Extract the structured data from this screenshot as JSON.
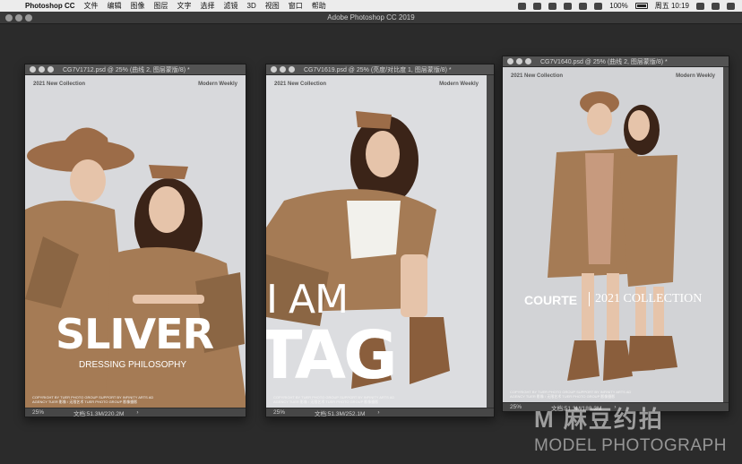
{
  "menubar": {
    "app_name": "Photoshop CC",
    "items": [
      "文件",
      "编辑",
      "图像",
      "图层",
      "文字",
      "选择",
      "滤镜",
      "3D",
      "视图",
      "窗口",
      "帮助"
    ],
    "battery": "100%",
    "clock": "周五 10:19"
  },
  "app_title": "Adobe Photoshop CC 2019",
  "documents": [
    {
      "title": "CG7V1712.psd @ 25% (曲线 2, 图层蒙版/8) *",
      "zoom": "25%",
      "doc_info": "文档:51.3M/220.2M",
      "poster": {
        "top_left": "2021 New Collection",
        "top_right": "Modern Weekly",
        "headline": "SLIVER",
        "subhead": "DRESSING PHILOSOPHY",
        "copyright": "COPYRIGHT BY TUER PHOTO GROUP SUPPORT BY INFINITY ARTS AD AGENCY TUER 影像 / 无限艺术 TUER PHOTO GROUP 影像摄影"
      }
    },
    {
      "title": "CG7V1619.psd @ 25% (亮度/对比度 1, 图层蒙版/8) *",
      "zoom": "25%",
      "doc_info": "文档:51.3M/252.1M",
      "poster": {
        "top_left": "2021 New Collection",
        "top_right": "Modern Weekly",
        "headline_1": "I AM",
        "headline_2": "TAG",
        "copyright": "COPYRIGHT BY TUER PHOTO GROUP SUPPORT BY INFINITY ARTS AD AGENCY TUER 影像 / 无限艺术 TUER PHOTO GROUP 影像摄影"
      }
    },
    {
      "title": "CG7V1640.psd @ 25% (曲线 2, 图层蒙版/8) *",
      "zoom": "25%",
      "doc_info": "文档:51.3M/188.3M",
      "poster": {
        "top_left": "2021 New Collection",
        "top_right": "Modern Weekly",
        "headline_1": "COURTE",
        "headline_2": "2021 COLLECTION",
        "copyright": "COPYRIGHT BY TUER PHOTO GROUP SUPPORT BY INFINITY ARTS AD AGENCY TUER 影像 / 无限艺术 TUER PHOTO GROUP 影像摄影"
      }
    }
  ],
  "watermark": {
    "brand_cn": "M 麻豆约拍",
    "brand_en": "MODEL PHOTOGRAPH"
  }
}
